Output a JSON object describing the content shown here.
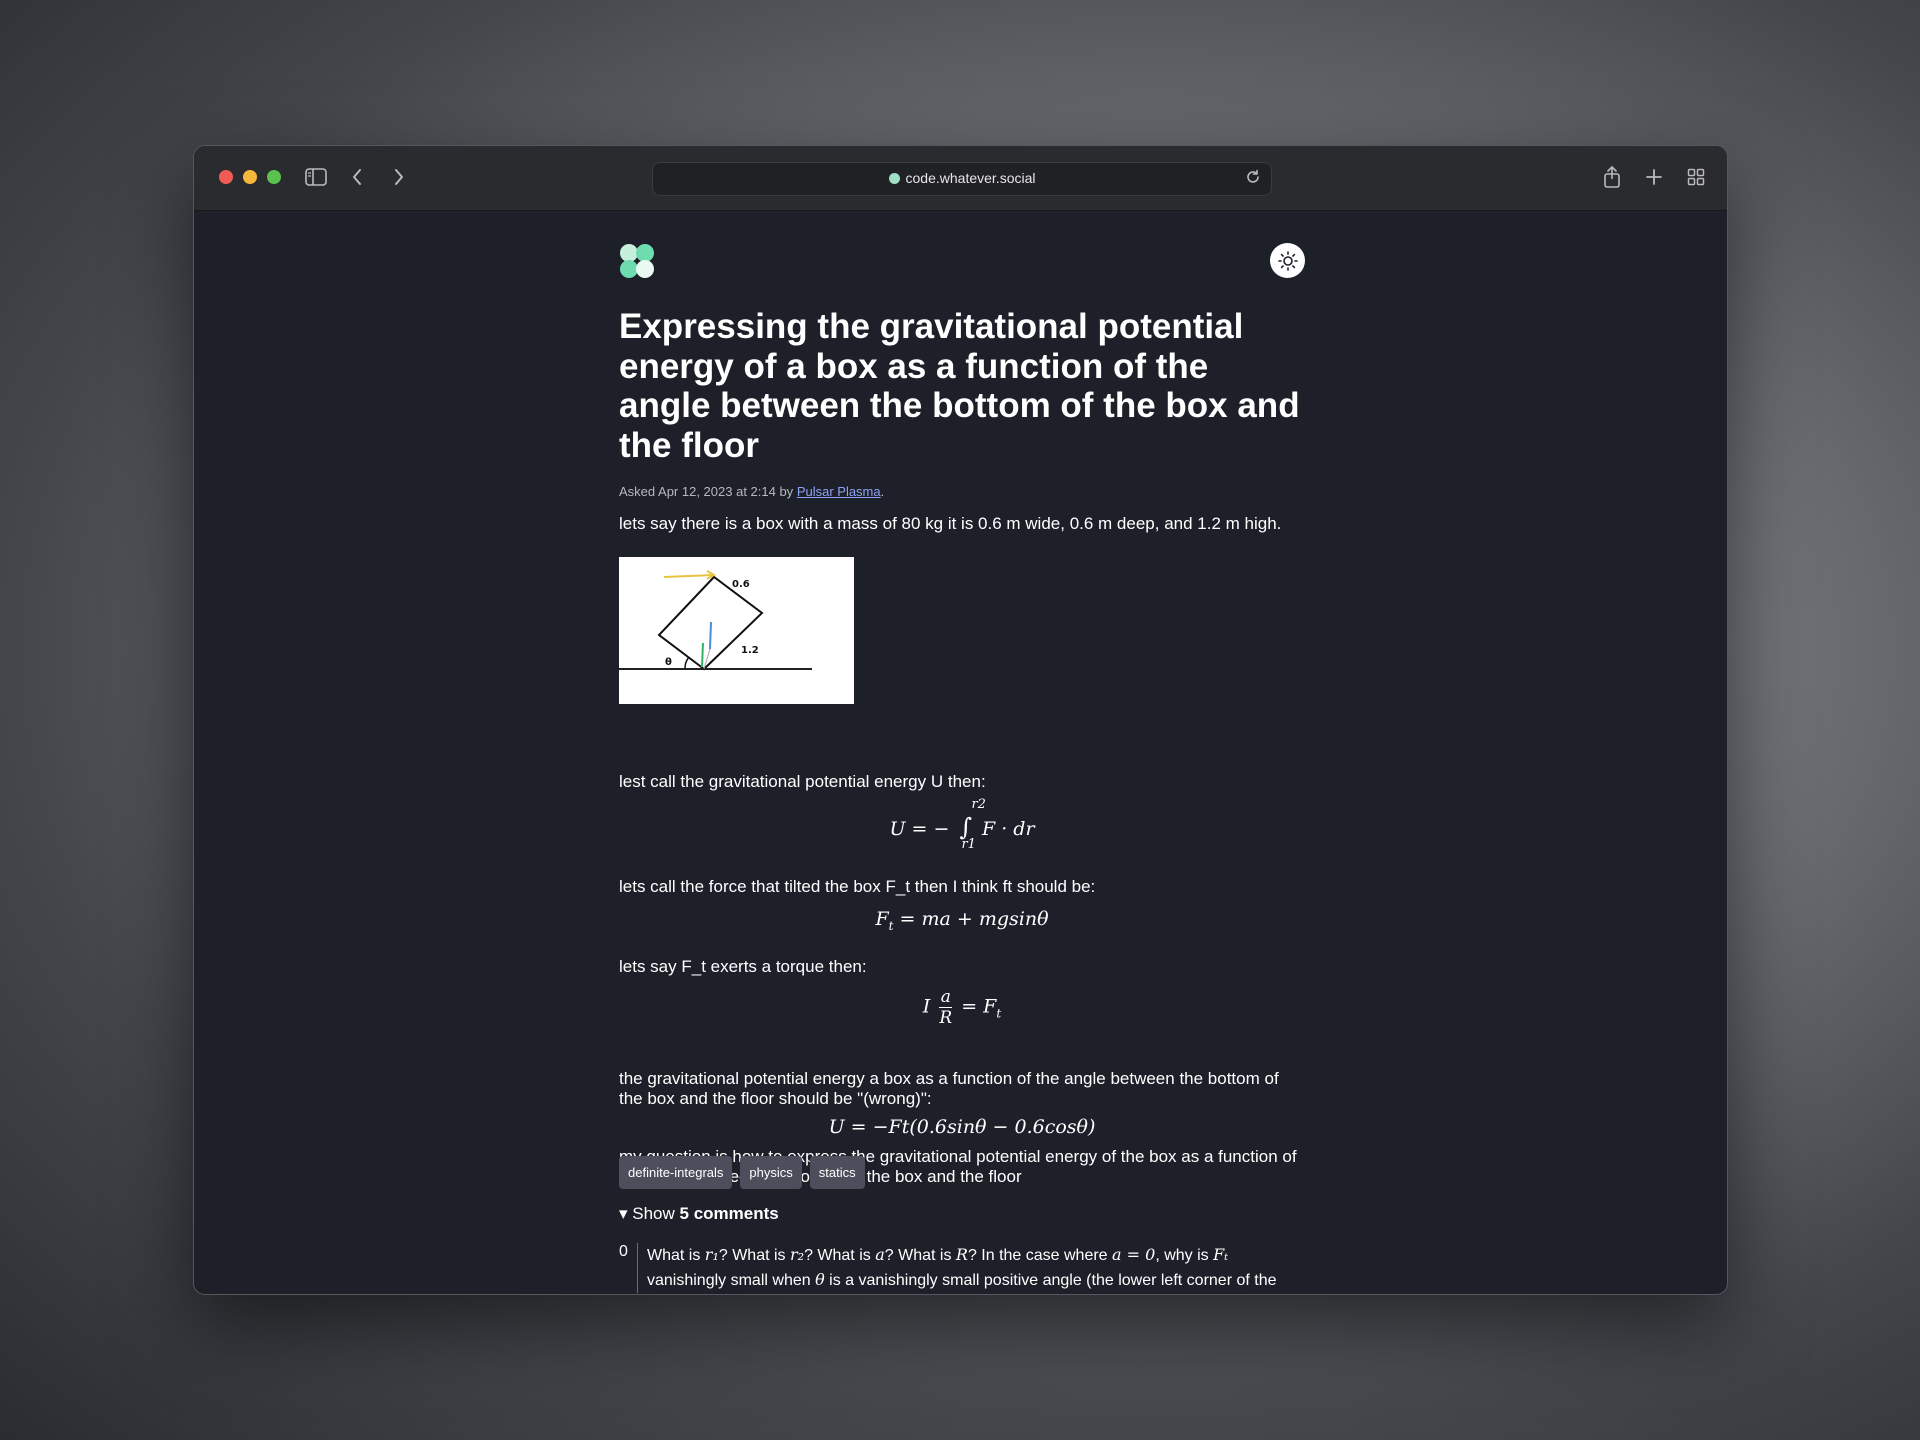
{
  "browser": {
    "url": "code.whatever.social"
  },
  "question": {
    "title": "Expressing the gravitational potential energy of a box as a function of the angle between the bottom of the box and the floor",
    "meta_prefix": "Asked Apr 12, 2023 at 2:14 by",
    "author": "Pulsar Plasma",
    "meta_suffix": ".",
    "p1": "lets say there is a box with a mass of 80 kg it is 0.6 m wide, 0.6 m deep, and 1.2 m high.",
    "figure_labels": {
      "top": "0.6",
      "side": "1.2",
      "angle": "θ"
    },
    "p2": "lest call the gravitational potential energy U then:",
    "eq1": {
      "lhs": "U = −",
      "integral": "∫",
      "upper": "r2",
      "lower": "r1",
      "rhs": "F · dr"
    },
    "p3": "lets call the force that tilted the box F_t then I think ft should be:",
    "eq2": {
      "lhs": "F",
      "sub": "t",
      "rhs": " = ma + mgsinθ"
    },
    "p4": "lets say F_t exerts a torque then:",
    "eq3": {
      "lead": "I",
      "num": "a",
      "den": "R",
      "rhs": "= F",
      "sub": "t"
    },
    "p5": "the gravitational potential energy a box as a function of the angle between the bottom of the box and the floor should be \"(wrong)\":",
    "eq4": "U = −Ft(0.6sinθ − 0.6cosθ)",
    "p6": "my question is how to express the gravitational potential energy of the box as a function of the angle between the bottom of the box and the floor",
    "tags": [
      "definite-integrals",
      "physics",
      "statics"
    ],
    "comments_toggle_prefix": "▾ Show",
    "comments_toggle_count": "5 comments",
    "comment": {
      "score": "0",
      "line1_a": "What is ",
      "line1_r1": "r₁",
      "line1_b": "? What is ",
      "line1_r2": "r₂",
      "line1_c": "? What is ",
      "line1_a_var": "a",
      "line1_d": "? What is ",
      "line1_R": "R",
      "line1_e": "? In the case where ",
      "line1_eq": "a = 0",
      "line1_f": ", why is ",
      "line1_Ft": "Fₜ",
      "line2_a": "vanishingly small when ",
      "line2_theta": "θ",
      "line2_b": " is a vanishingly small positive angle (the lower left corner of the"
    }
  },
  "colors": {
    "page_bg": "#1d2029",
    "tag_bg": "#4c4e5c",
    "link": "#8da2f5"
  }
}
